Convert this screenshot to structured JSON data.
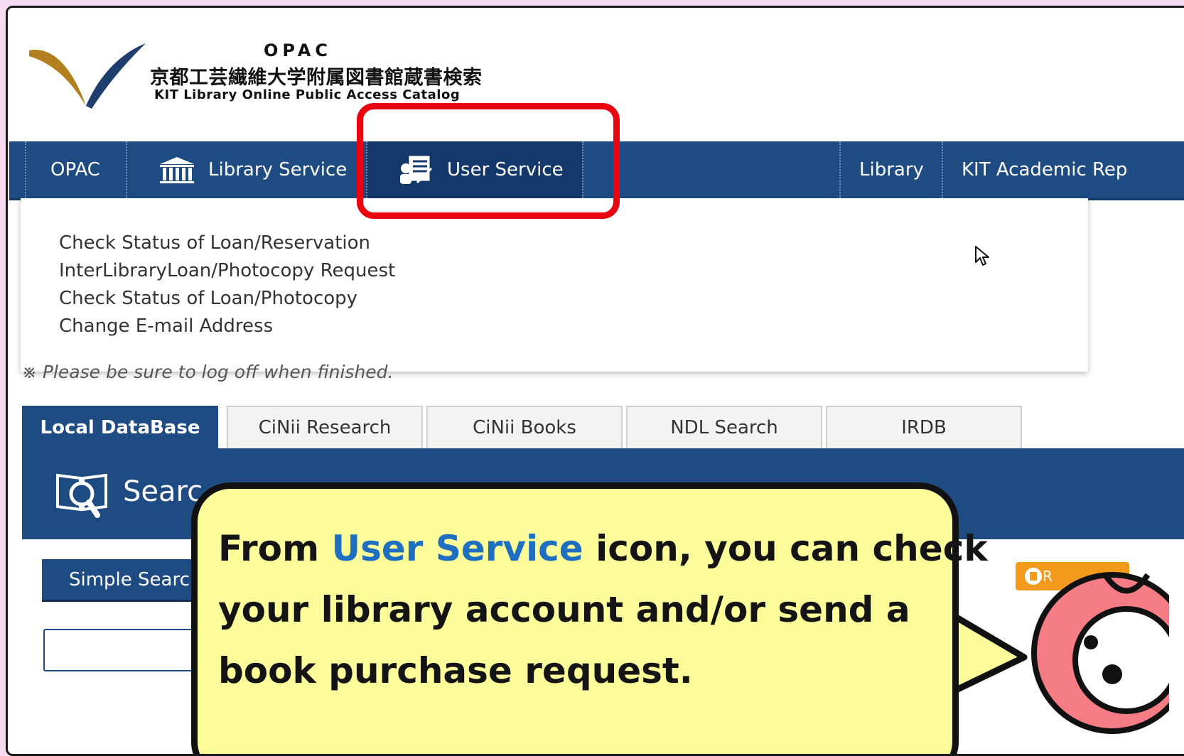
{
  "header": {
    "logo_opac": "OPAC",
    "logo_japanese": "京都工芸繊維大学附属図書館蔵書検索",
    "logo_english": "KIT Library Online Public Access Catalog"
  },
  "nav": {
    "items": [
      {
        "label": "OPAC",
        "icon": "none"
      },
      {
        "label": "Library Service",
        "icon": "library-building-icon"
      },
      {
        "label": "User Service",
        "icon": "user-document-icon",
        "active": true
      },
      {
        "label": "Library",
        "icon": "none"
      },
      {
        "label": "KIT Academic Rep",
        "icon": "none"
      }
    ]
  },
  "dropdown": {
    "items": [
      "Check Status of Loan/Reservation",
      "InterLibraryLoan/Photocopy Request",
      "Check Status of Loan/Photocopy",
      "Change E-mail Address"
    ]
  },
  "notice": "※ Please be sure to log off when finished.",
  "tabs": [
    {
      "label": "Local DataBase",
      "active": true
    },
    {
      "label": "CiNii Research"
    },
    {
      "label": "CiNii Books"
    },
    {
      "label": "NDL Search"
    },
    {
      "label": "IRDB"
    }
  ],
  "search": {
    "title": "Searc",
    "simple_search_label": "Simple Search",
    "orange_button_label": "R"
  },
  "callout": {
    "line1_prefix": "From ",
    "line1_accent": "User Service",
    "line1_suffix": " icon, you can check",
    "line2": " your library account and/or send a",
    "line3": "book purchase request."
  },
  "colors": {
    "nav_blue": "#1e4c82",
    "highlight_red": "#e8050f",
    "callout_yellow": "#fcfc9a",
    "accent_blue": "#1f6fc0",
    "background_pink": "#f6dbf1"
  }
}
